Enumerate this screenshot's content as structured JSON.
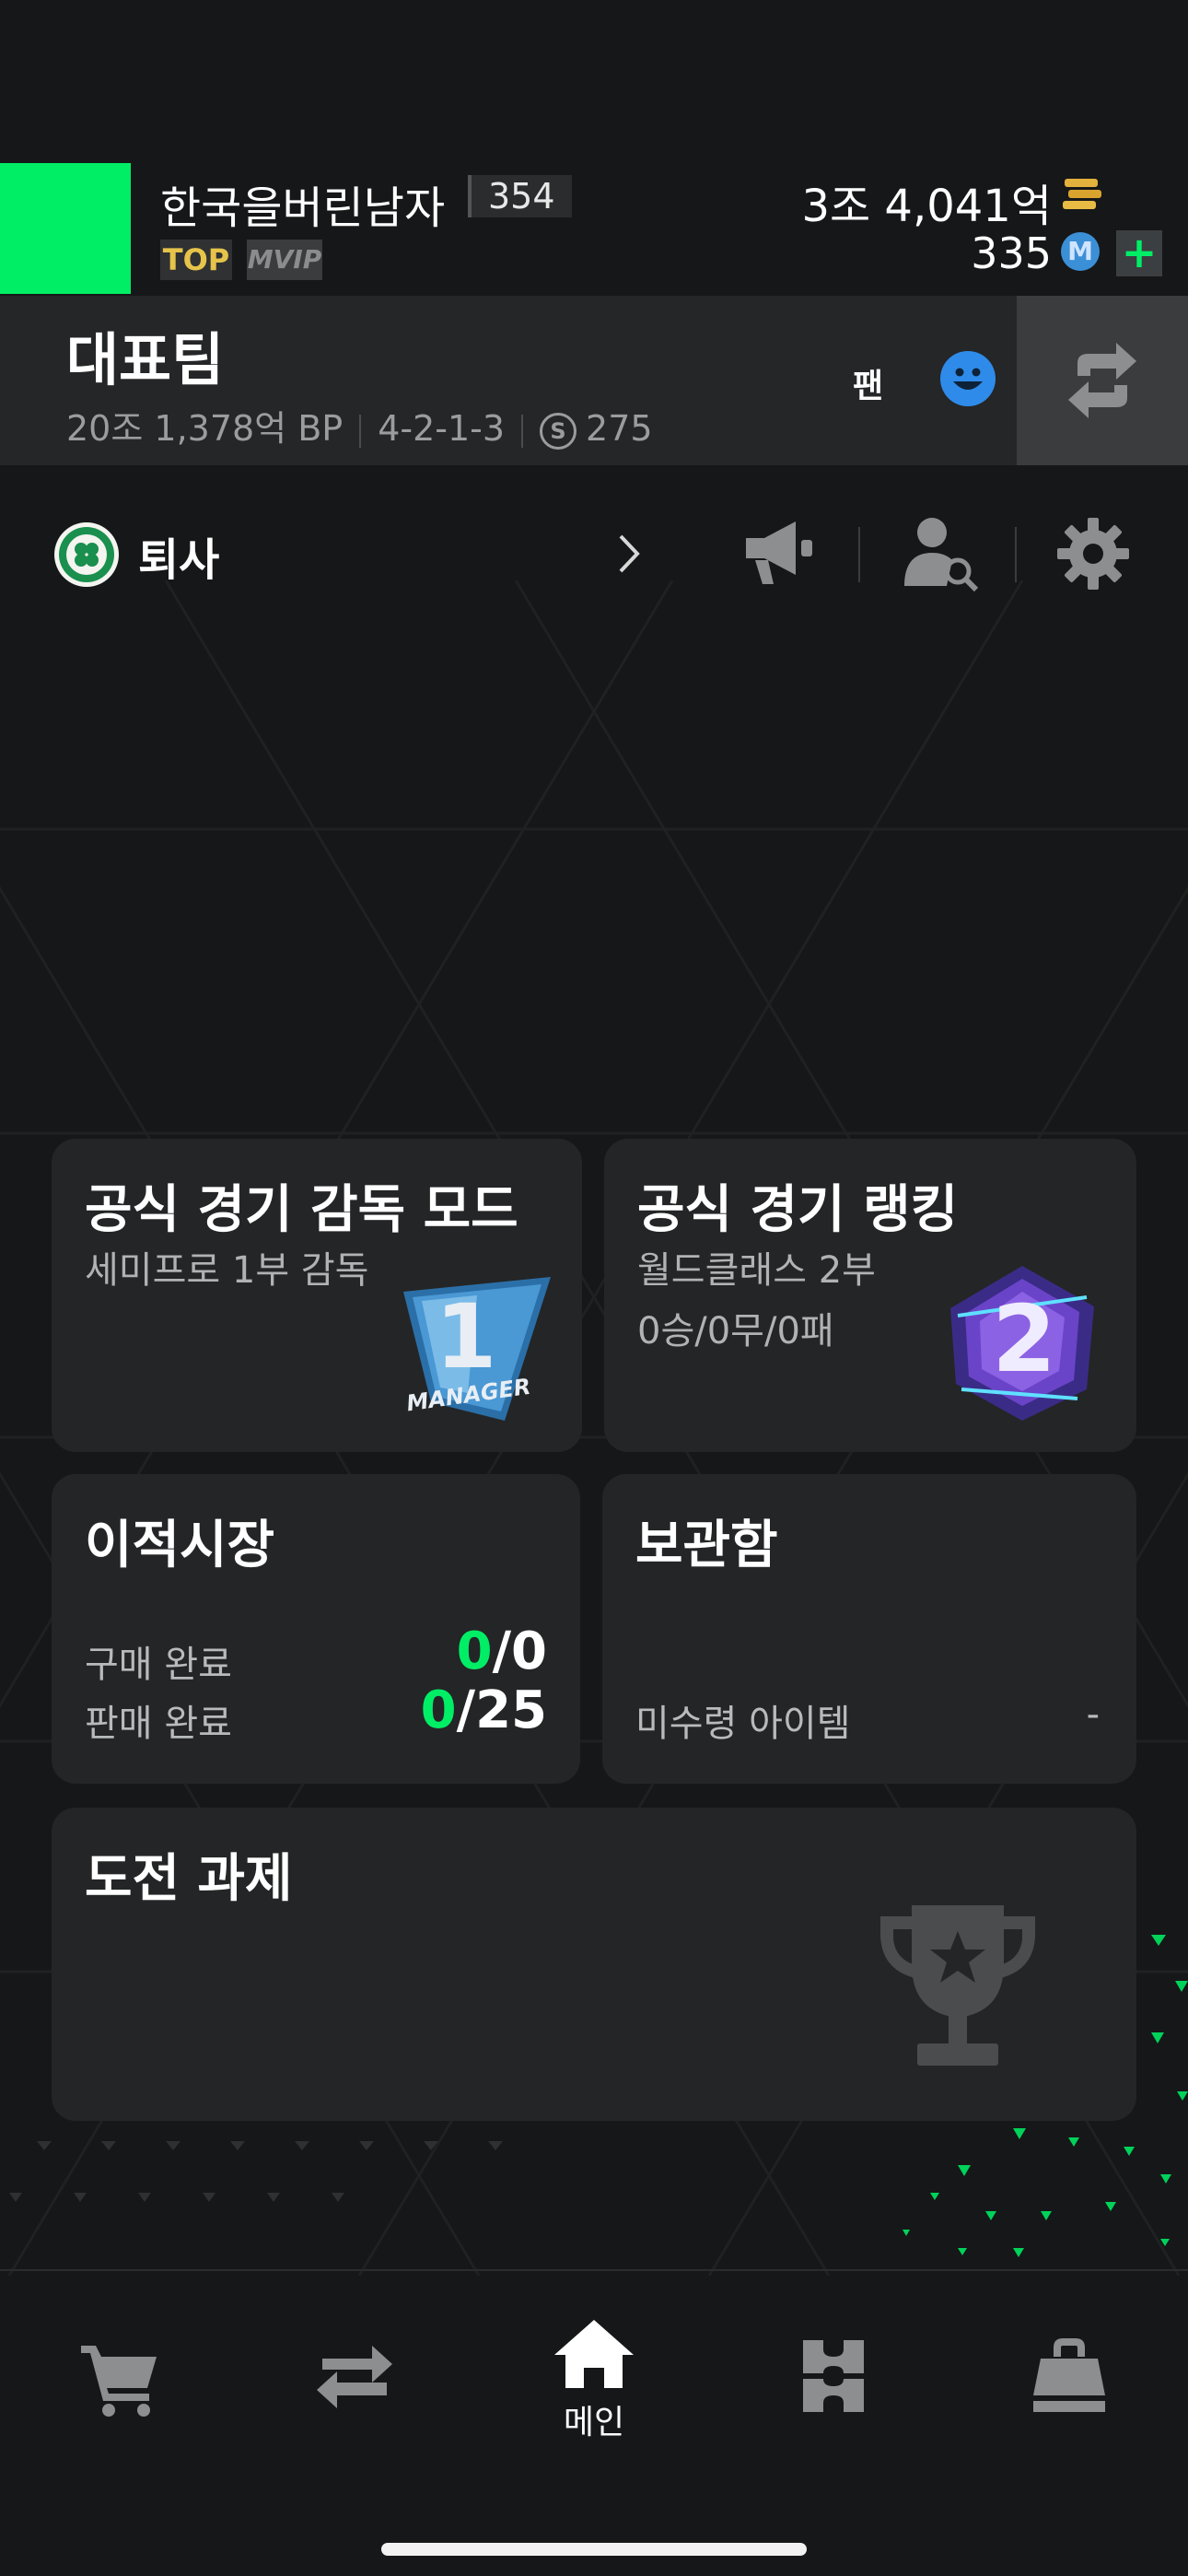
{
  "profile": {
    "nickname": "한국을버린남자",
    "level": "354",
    "badge_top": "TOP",
    "badge_vip": "VIP"
  },
  "currency": {
    "bp": "3조 4,041억",
    "mc": "335",
    "mc_icon_letter": "M",
    "add_label": "+"
  },
  "team": {
    "name": "대표팀",
    "value": "20조 1,378억 BP",
    "formation": "4-2-1-3",
    "salary_icon_letter": "S",
    "salary": "275",
    "fan_label": "팬"
  },
  "club": {
    "name": "퇴사"
  },
  "cards": {
    "manager_mode": {
      "title": "공식 경기 감독 모드",
      "subtitle": "세미프로 1부 감독",
      "emblem_number": "1",
      "emblem_text": "MANAGER"
    },
    "ranking": {
      "title": "공식 경기 랭킹",
      "subtitle": "월드클래스 2부",
      "record": "0승/0무/0패",
      "emblem_number": "2"
    },
    "transfer": {
      "title": "이적시장",
      "buy_label": "구매 완료",
      "buy_done": "0",
      "buy_total": "/0",
      "sell_label": "판매 완료",
      "sell_done": "0",
      "sell_total": "/25"
    },
    "storage": {
      "title": "보관함",
      "unclaimed_label": "미수령 아이템",
      "unclaimed_value": "-"
    },
    "challenge": {
      "title": "도전 과제"
    }
  },
  "nav": {
    "items": [
      {
        "icon": "cart-icon"
      },
      {
        "icon": "transfer-arrows-icon"
      },
      {
        "icon": "home-icon",
        "label": "메인",
        "active": true
      },
      {
        "icon": "squad-field-icon"
      },
      {
        "icon": "bag-icon"
      }
    ]
  },
  "colors": {
    "accent_green": "#00ee66",
    "background": "#161718",
    "card": "#242526"
  }
}
